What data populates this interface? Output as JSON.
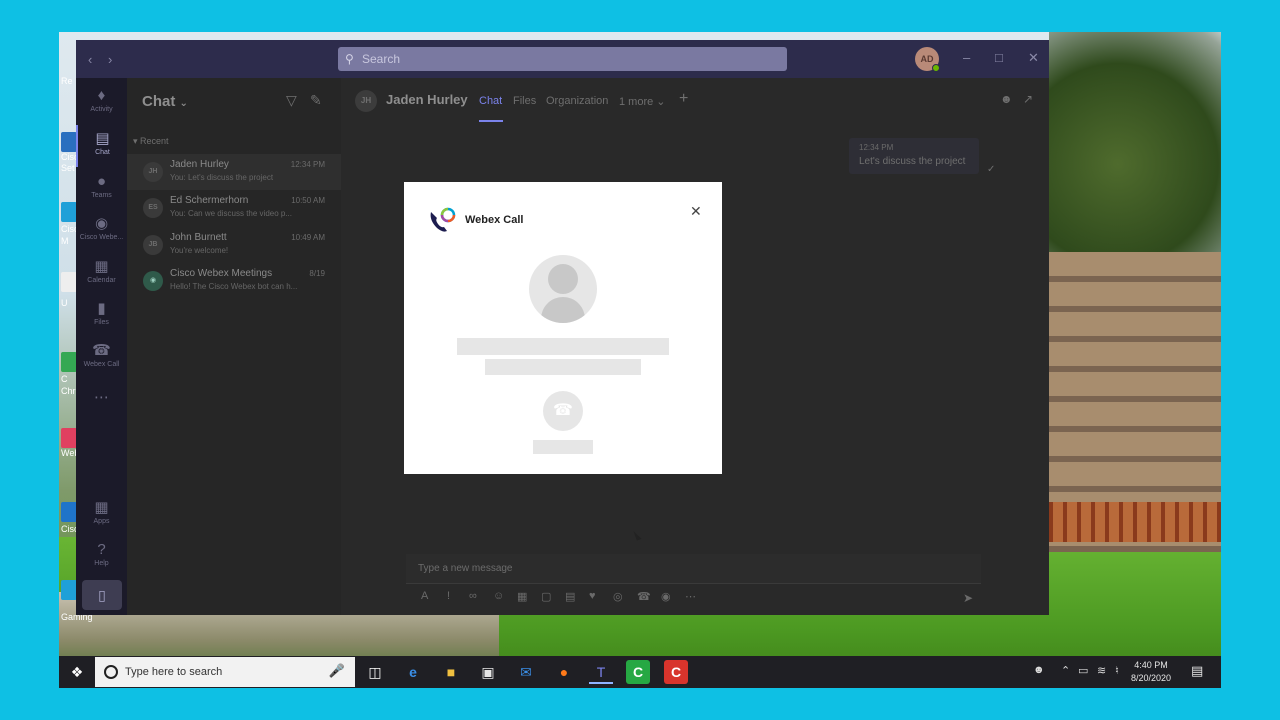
{
  "teams": {
    "search_placeholder": "Search",
    "user_initials": "AD",
    "rail": [
      {
        "label": "Activity",
        "icon": "bell-icon"
      },
      {
        "label": "Chat",
        "icon": "chat-icon"
      },
      {
        "label": "Teams",
        "icon": "teams-icon"
      },
      {
        "label": "Cisco Webe...",
        "icon": "webex-icon"
      },
      {
        "label": "Calendar",
        "icon": "calendar-icon"
      },
      {
        "label": "Files",
        "icon": "files-icon"
      },
      {
        "label": "Webex Call",
        "icon": "webex-call-icon"
      },
      {
        "label": "Apps",
        "icon": "apps-icon"
      },
      {
        "label": "Help",
        "icon": "help-icon"
      }
    ],
    "panel_title": "Chat",
    "recent_label": "Recent",
    "chats": [
      {
        "initials": "JH",
        "name": "Jaden Hurley",
        "time": "12:34 PM",
        "preview": "You: Let's discuss the project"
      },
      {
        "initials": "ES",
        "name": "Ed Schermerhorn",
        "time": "10:50 AM",
        "preview": "You: Can we discuss the video p..."
      },
      {
        "initials": "JB",
        "name": "John Burnett",
        "time": "10:49 AM",
        "preview": "You're welcome!"
      },
      {
        "initials": "",
        "name": "Cisco Webex Meetings",
        "time": "8/19",
        "preview": "Hello! The Cisco Webex bot can h..."
      }
    ],
    "conversation": {
      "initials": "JH",
      "name": "Jaden Hurley",
      "tabs": [
        "Chat",
        "Files",
        "Organization",
        "1 more"
      ],
      "message_time": "12:34 PM",
      "message_text": "Let's discuss the project",
      "compose_placeholder": "Type a new message"
    }
  },
  "modal": {
    "title": "Webex Call",
    "logo_colors": [
      "#1d1d4f",
      "#8dc63f",
      "#f15a24",
      "#00a0d1",
      "#a349a4"
    ]
  },
  "taskbar": {
    "search_placeholder": "Type here to search",
    "time": "4:40 PM",
    "date": "8/20/2020"
  },
  "desktop": {
    "labels": [
      "Re",
      "Cisc",
      "Set",
      "Cisc",
      "M",
      "U",
      "C",
      "Chr",
      "Web",
      "Cisc",
      "Gaming"
    ]
  }
}
